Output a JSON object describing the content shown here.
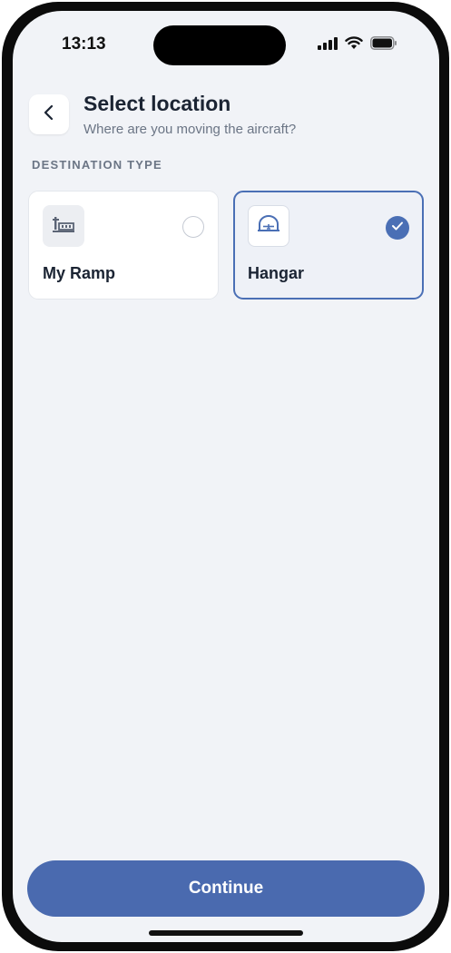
{
  "status_bar": {
    "time": "13:13",
    "icons": [
      "cellular-signal-icon",
      "wifi-icon",
      "battery-icon"
    ]
  },
  "header": {
    "back_icon": "chevron-left-icon",
    "title": "Select location",
    "subtitle": "Where are you moving the aircraft?"
  },
  "section": {
    "label": "DESTINATION TYPE"
  },
  "options": [
    {
      "label": "My Ramp",
      "icon": "ramp-icon",
      "selected": false
    },
    {
      "label": "Hangar",
      "icon": "hangar-icon",
      "selected": true
    }
  ],
  "footer": {
    "continue_label": "Continue"
  },
  "colors": {
    "accent": "#4a6fb5",
    "background": "#f1f3f7",
    "text_primary": "#1b2433",
    "text_secondary": "#6b7585"
  }
}
